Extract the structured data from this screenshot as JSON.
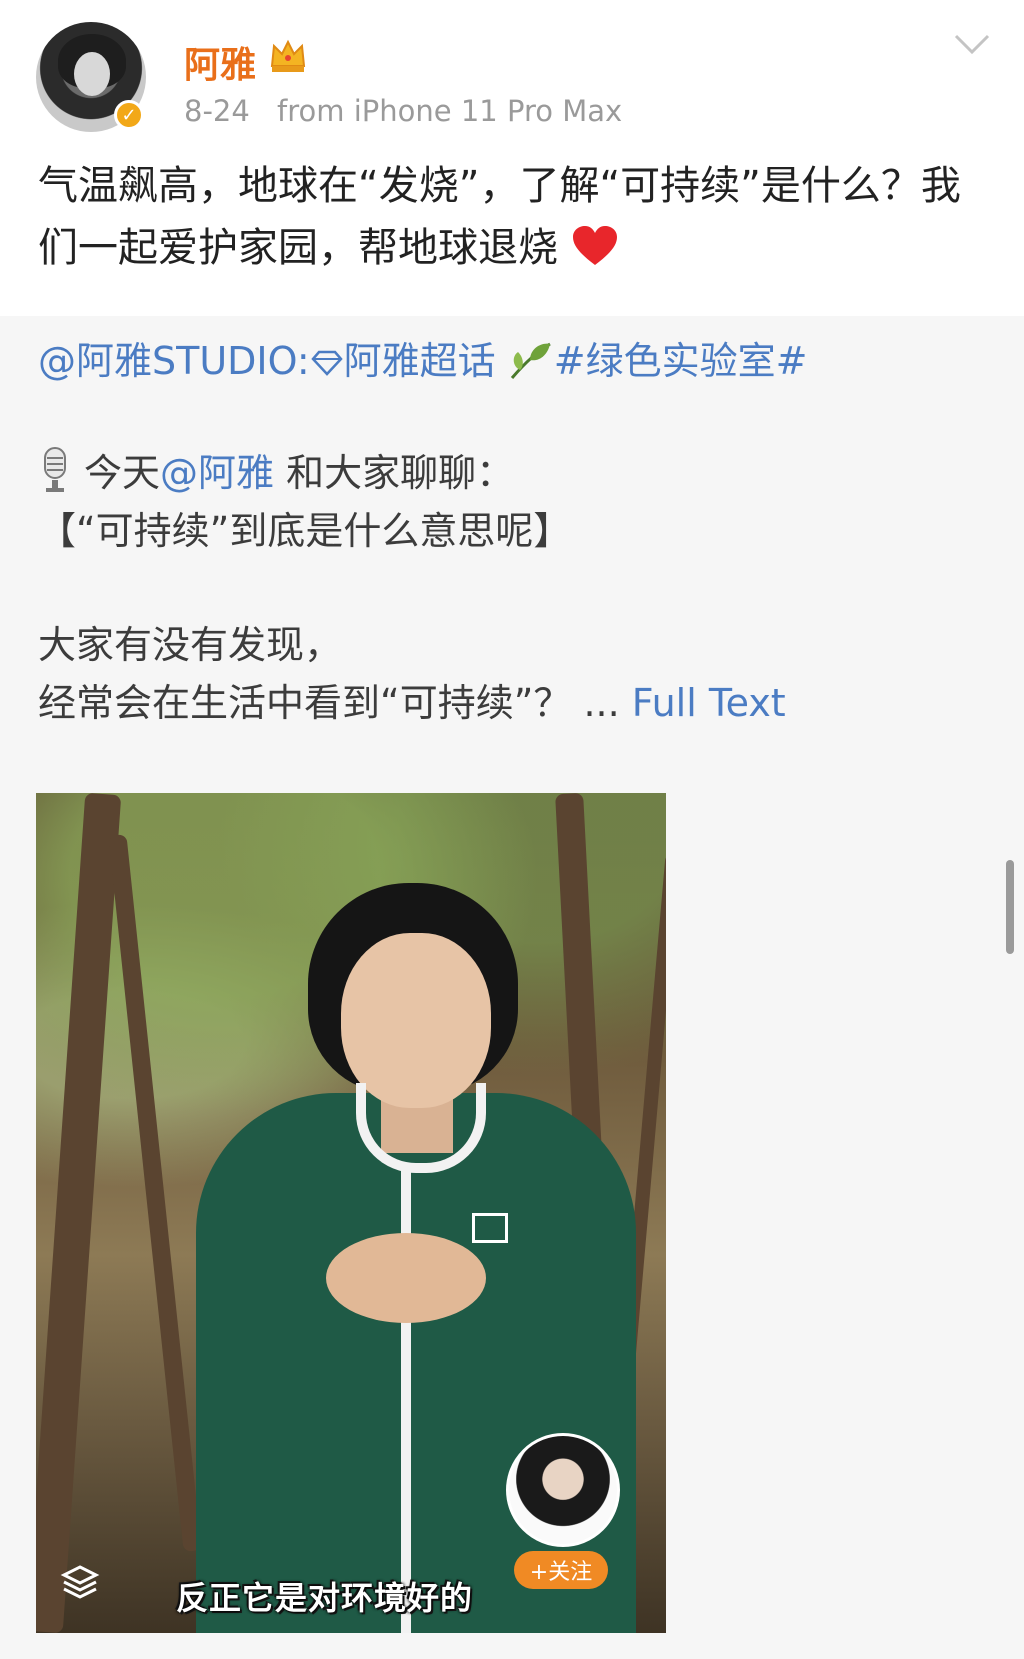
{
  "post": {
    "username": "阿雅",
    "date": "8-24",
    "source": "from iPhone 11 Pro Max",
    "text": "气温飙高，地球在“发烧”，了解“可持续”是什么？我们一起爱护家园，帮地球退烧"
  },
  "repost": {
    "author_link": "@阿雅STUDIO:",
    "supertopic": "阿雅超话",
    "hashtag": "#绿色实验室#",
    "line2_prefix": "今天",
    "mention": "@阿雅",
    "line2_suffix": " 和大家聊聊：",
    "line3": "【“可持续”到底是什么意思呢】",
    "line4": "大家有没有发现，",
    "line5": "经常会在生活中看到“可持续”？ ...",
    "full_text": "Full Text"
  },
  "video": {
    "caption": "反正它是对环境好的",
    "follow_label": "+关注"
  },
  "colors": {
    "username": "#e96f1a",
    "link": "#4b7cc3",
    "repost_bg": "#f6f6f6",
    "badge": "#f2a818",
    "heart": "#e8262b"
  },
  "icons": [
    "crown-icon",
    "verified-badge-icon",
    "chevron-down-icon",
    "heart-icon",
    "gem-icon",
    "leaf-icon",
    "mic-icon",
    "layers-icon"
  ]
}
